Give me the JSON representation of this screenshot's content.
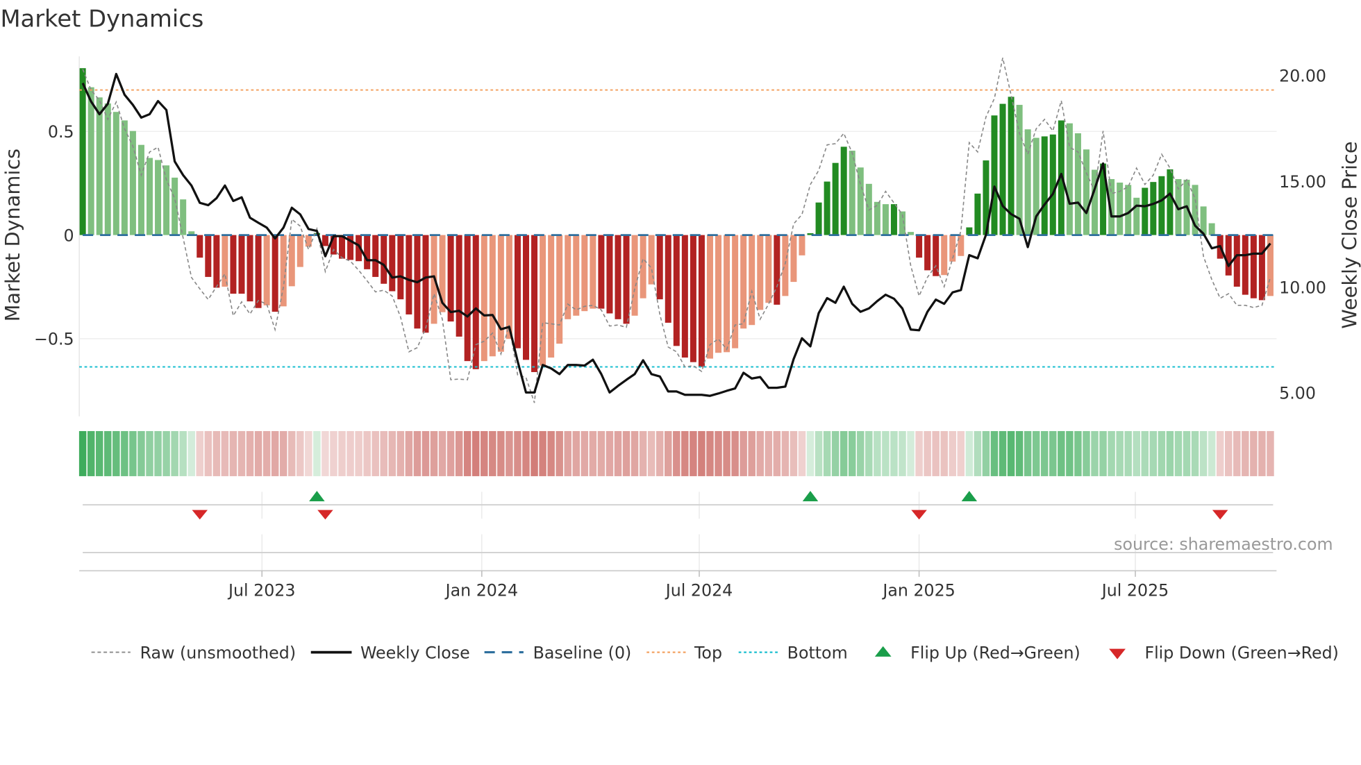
{
  "chart_data": {
    "type": "bar",
    "title": "Market Dynamics",
    "ylabel": "Market Dynamics",
    "y2label": "Weekly Close Price",
    "source": "source: sharemaestro.com",
    "x_start": "2023-02-01",
    "x_freq_days": 7,
    "ylim": [
      -0.875,
      0.86
    ],
    "y2lim": [
      3.2,
      20.7
    ],
    "yticks": [
      {
        "v": 0.5,
        "label": "0.5"
      },
      {
        "v": 0,
        "label": "0"
      },
      {
        "v": -0.5,
        "label": "−0.5"
      }
    ],
    "y2ticks": [
      {
        "v": 20,
        "label": "20.00"
      },
      {
        "v": 15,
        "label": "15.00"
      },
      {
        "v": 10,
        "label": "10.00"
      },
      {
        "v": 5,
        "label": "5.00"
      }
    ],
    "xticks": [
      {
        "date": "2023-07-01",
        "label": "Jul 2023"
      },
      {
        "date": "2024-01-01",
        "label": "Jan 2024"
      },
      {
        "date": "2024-07-01",
        "label": "Jul 2024"
      },
      {
        "date": "2025-01-01",
        "label": "Jan 2025"
      },
      {
        "date": "2025-07-01",
        "label": "Jul 2025"
      }
    ],
    "top_level": 0.7,
    "bottom_level": -0.636,
    "baseline": 0,
    "series": [
      {
        "name": "Market Dynamics",
        "values": [
          0.805,
          0.713,
          0.664,
          0.635,
          0.594,
          0.553,
          0.502,
          0.435,
          0.372,
          0.362,
          0.336,
          0.277,
          0.172,
          0.018,
          -0.109,
          -0.202,
          -0.254,
          -0.249,
          -0.283,
          -0.283,
          -0.32,
          -0.352,
          -0.339,
          -0.37,
          -0.344,
          -0.247,
          -0.154,
          -0.056,
          0.01,
          -0.053,
          -0.094,
          -0.114,
          -0.12,
          -0.126,
          -0.165,
          -0.202,
          -0.235,
          -0.271,
          -0.31,
          -0.383,
          -0.451,
          -0.471,
          -0.428,
          -0.372,
          -0.417,
          -0.49,
          -0.608,
          -0.647,
          -0.608,
          -0.585,
          -0.563,
          -0.501,
          -0.546,
          -0.602,
          -0.661,
          -0.63,
          -0.591,
          -0.524,
          -0.406,
          -0.389,
          -0.367,
          -0.355,
          -0.355,
          -0.378,
          -0.406,
          -0.428,
          -0.389,
          -0.305,
          -0.238,
          -0.31,
          -0.423,
          -0.535,
          -0.591,
          -0.613,
          -0.636,
          -0.596,
          -0.568,
          -0.565,
          -0.546,
          -0.451,
          -0.434,
          -0.361,
          -0.327,
          -0.336,
          -0.294,
          -0.226,
          -0.098,
          0.009,
          0.157,
          0.258,
          0.348,
          0.426,
          0.407,
          0.326,
          0.247,
          0.16,
          0.149,
          0.149,
          0.114,
          0.015,
          -0.109,
          -0.17,
          -0.198,
          -0.193,
          -0.128,
          -0.101,
          0.037,
          0.2,
          0.36,
          0.577,
          0.633,
          0.667,
          0.628,
          0.51,
          0.469,
          0.476,
          0.485,
          0.553,
          0.539,
          0.491,
          0.413,
          0.315,
          0.345,
          0.27,
          0.253,
          0.242,
          0.18,
          0.228,
          0.256,
          0.284,
          0.317,
          0.27,
          0.267,
          0.242,
          0.138,
          0.057,
          -0.114,
          -0.195,
          -0.249,
          -0.288,
          -0.305,
          -0.314,
          -0.294
        ]
      },
      {
        "name": "Raw (unsmoothed)",
        "values": [
          0.8,
          0.7,
          0.65,
          0.558,
          0.642,
          0.513,
          0.429,
          0.289,
          0.401,
          0.424,
          0.267,
          0.177,
          -0.013,
          -0.204,
          -0.26,
          -0.311,
          -0.249,
          -0.187,
          -0.389,
          -0.322,
          -0.381,
          -0.316,
          -0.333,
          -0.456,
          -0.249,
          0.076,
          0.043,
          -0.07,
          0.03,
          -0.176,
          -0.07,
          -0.109,
          -0.126,
          -0.17,
          -0.221,
          -0.274,
          -0.266,
          -0.294,
          -0.395,
          -0.563,
          -0.543,
          -0.451,
          -0.283,
          -0.406,
          -0.698,
          -0.695,
          -0.698,
          -0.529,
          -0.512,
          -0.473,
          -0.574,
          -0.434,
          -0.675,
          -0.687,
          -0.809,
          -0.423,
          -0.428,
          -0.434,
          -0.333,
          -0.361,
          -0.344,
          -0.339,
          -0.361,
          -0.439,
          -0.434,
          -0.445,
          -0.26,
          -0.114,
          -0.159,
          -0.383,
          -0.54,
          -0.563,
          -0.636,
          -0.63,
          -0.658,
          -0.529,
          -0.501,
          -0.552,
          -0.434,
          -0.428,
          -0.271,
          -0.406,
          -0.333,
          -0.249,
          -0.137,
          0.054,
          0.099,
          0.244,
          0.312,
          0.435,
          0.441,
          0.491,
          0.396,
          0.244,
          0.121,
          0.143,
          0.211,
          0.155,
          0.099,
          -0.148,
          -0.294,
          -0.204,
          -0.148,
          -0.249,
          -0.114,
          0.02,
          0.446,
          0.401,
          0.57,
          0.659,
          0.855,
          0.676,
          0.491,
          0.39,
          0.513,
          0.558,
          0.502,
          0.648,
          0.424,
          0.401,
          0.3,
          0.211,
          0.502,
          0.2,
          0.211,
          0.233,
          0.323,
          0.244,
          0.289,
          0.39,
          0.323,
          0.222,
          0.267,
          0.177,
          -0.103,
          -0.215,
          -0.305,
          -0.283,
          -0.339,
          -0.339,
          -0.35,
          -0.339,
          -0.204
        ]
      },
      {
        "name": "Weekly Close",
        "axis": "right",
        "values": [
          19.64,
          18.77,
          18.17,
          18.66,
          20.07,
          19.09,
          18.61,
          18.01,
          18.17,
          18.79,
          18.37,
          15.94,
          15.29,
          14.8,
          13.98,
          13.87,
          14.2,
          14.8,
          14.07,
          14.24,
          13.28,
          13.04,
          12.81,
          12.3,
          12.81,
          13.75,
          13.44,
          12.74,
          12.65,
          11.46,
          12.41,
          12.41,
          12.19,
          11.97,
          11.27,
          11.27,
          11.05,
          10.45,
          10.51,
          10.34,
          10.23,
          10.45,
          10.51,
          9.26,
          8.82,
          8.88,
          8.61,
          8.99,
          8.66,
          8.68,
          8.01,
          8.12,
          6.49,
          5.02,
          5.02,
          6.32,
          6.16,
          5.89,
          6.32,
          6.32,
          6.29,
          6.57,
          5.89,
          5.02,
          5.33,
          5.62,
          5.89,
          6.54,
          5.89,
          5.78,
          5.07,
          5.07,
          4.91,
          4.91,
          4.91,
          4.86,
          4.97,
          5.1,
          5.21,
          5.95,
          5.68,
          5.75,
          5.24,
          5.24,
          5.3,
          6.6,
          7.58,
          7.2,
          8.77,
          9.48,
          9.26,
          10.02,
          9.21,
          8.83,
          8.99,
          9.34,
          9.64,
          9.45,
          8.99,
          7.99,
          7.96,
          8.83,
          9.41,
          9.21,
          9.75,
          9.86,
          11.51,
          11.36,
          12.47,
          14.75,
          13.83,
          13.45,
          13.23,
          11.89,
          13.34,
          13.9,
          14.4,
          15.35,
          13.94,
          13.99,
          13.5,
          14.64,
          15.84,
          13.34,
          13.34,
          13.5,
          13.85,
          13.82,
          13.93,
          14.1,
          14.42,
          13.68,
          13.82,
          12.9,
          12.52,
          11.83,
          11.94,
          11.0,
          11.51,
          11.51,
          11.58,
          11.58,
          12.06
        ]
      }
    ],
    "legend": {
      "placement": "bottom",
      "items": [
        "Raw (unsmoothed)",
        "Weekly Close",
        "Baseline (0)",
        "Top",
        "Bottom",
        "Flip Up (Red→Green)",
        "Flip Down (Green→Red)"
      ]
    },
    "colors": {
      "strong_up": "#228b22",
      "weak_up": "#7fbf7f",
      "strong_down": "#b22222",
      "weak_down": "#e9967a",
      "close": "#111111",
      "raw": "#888888",
      "baseline": "#2e6f9e",
      "top": "#f4a261",
      "bottom": "#17becf",
      "flip_up": "#1a9e4a",
      "flip_down": "#d62728",
      "strip_green": "#34a853",
      "strip_red": "#c8605a"
    }
  }
}
